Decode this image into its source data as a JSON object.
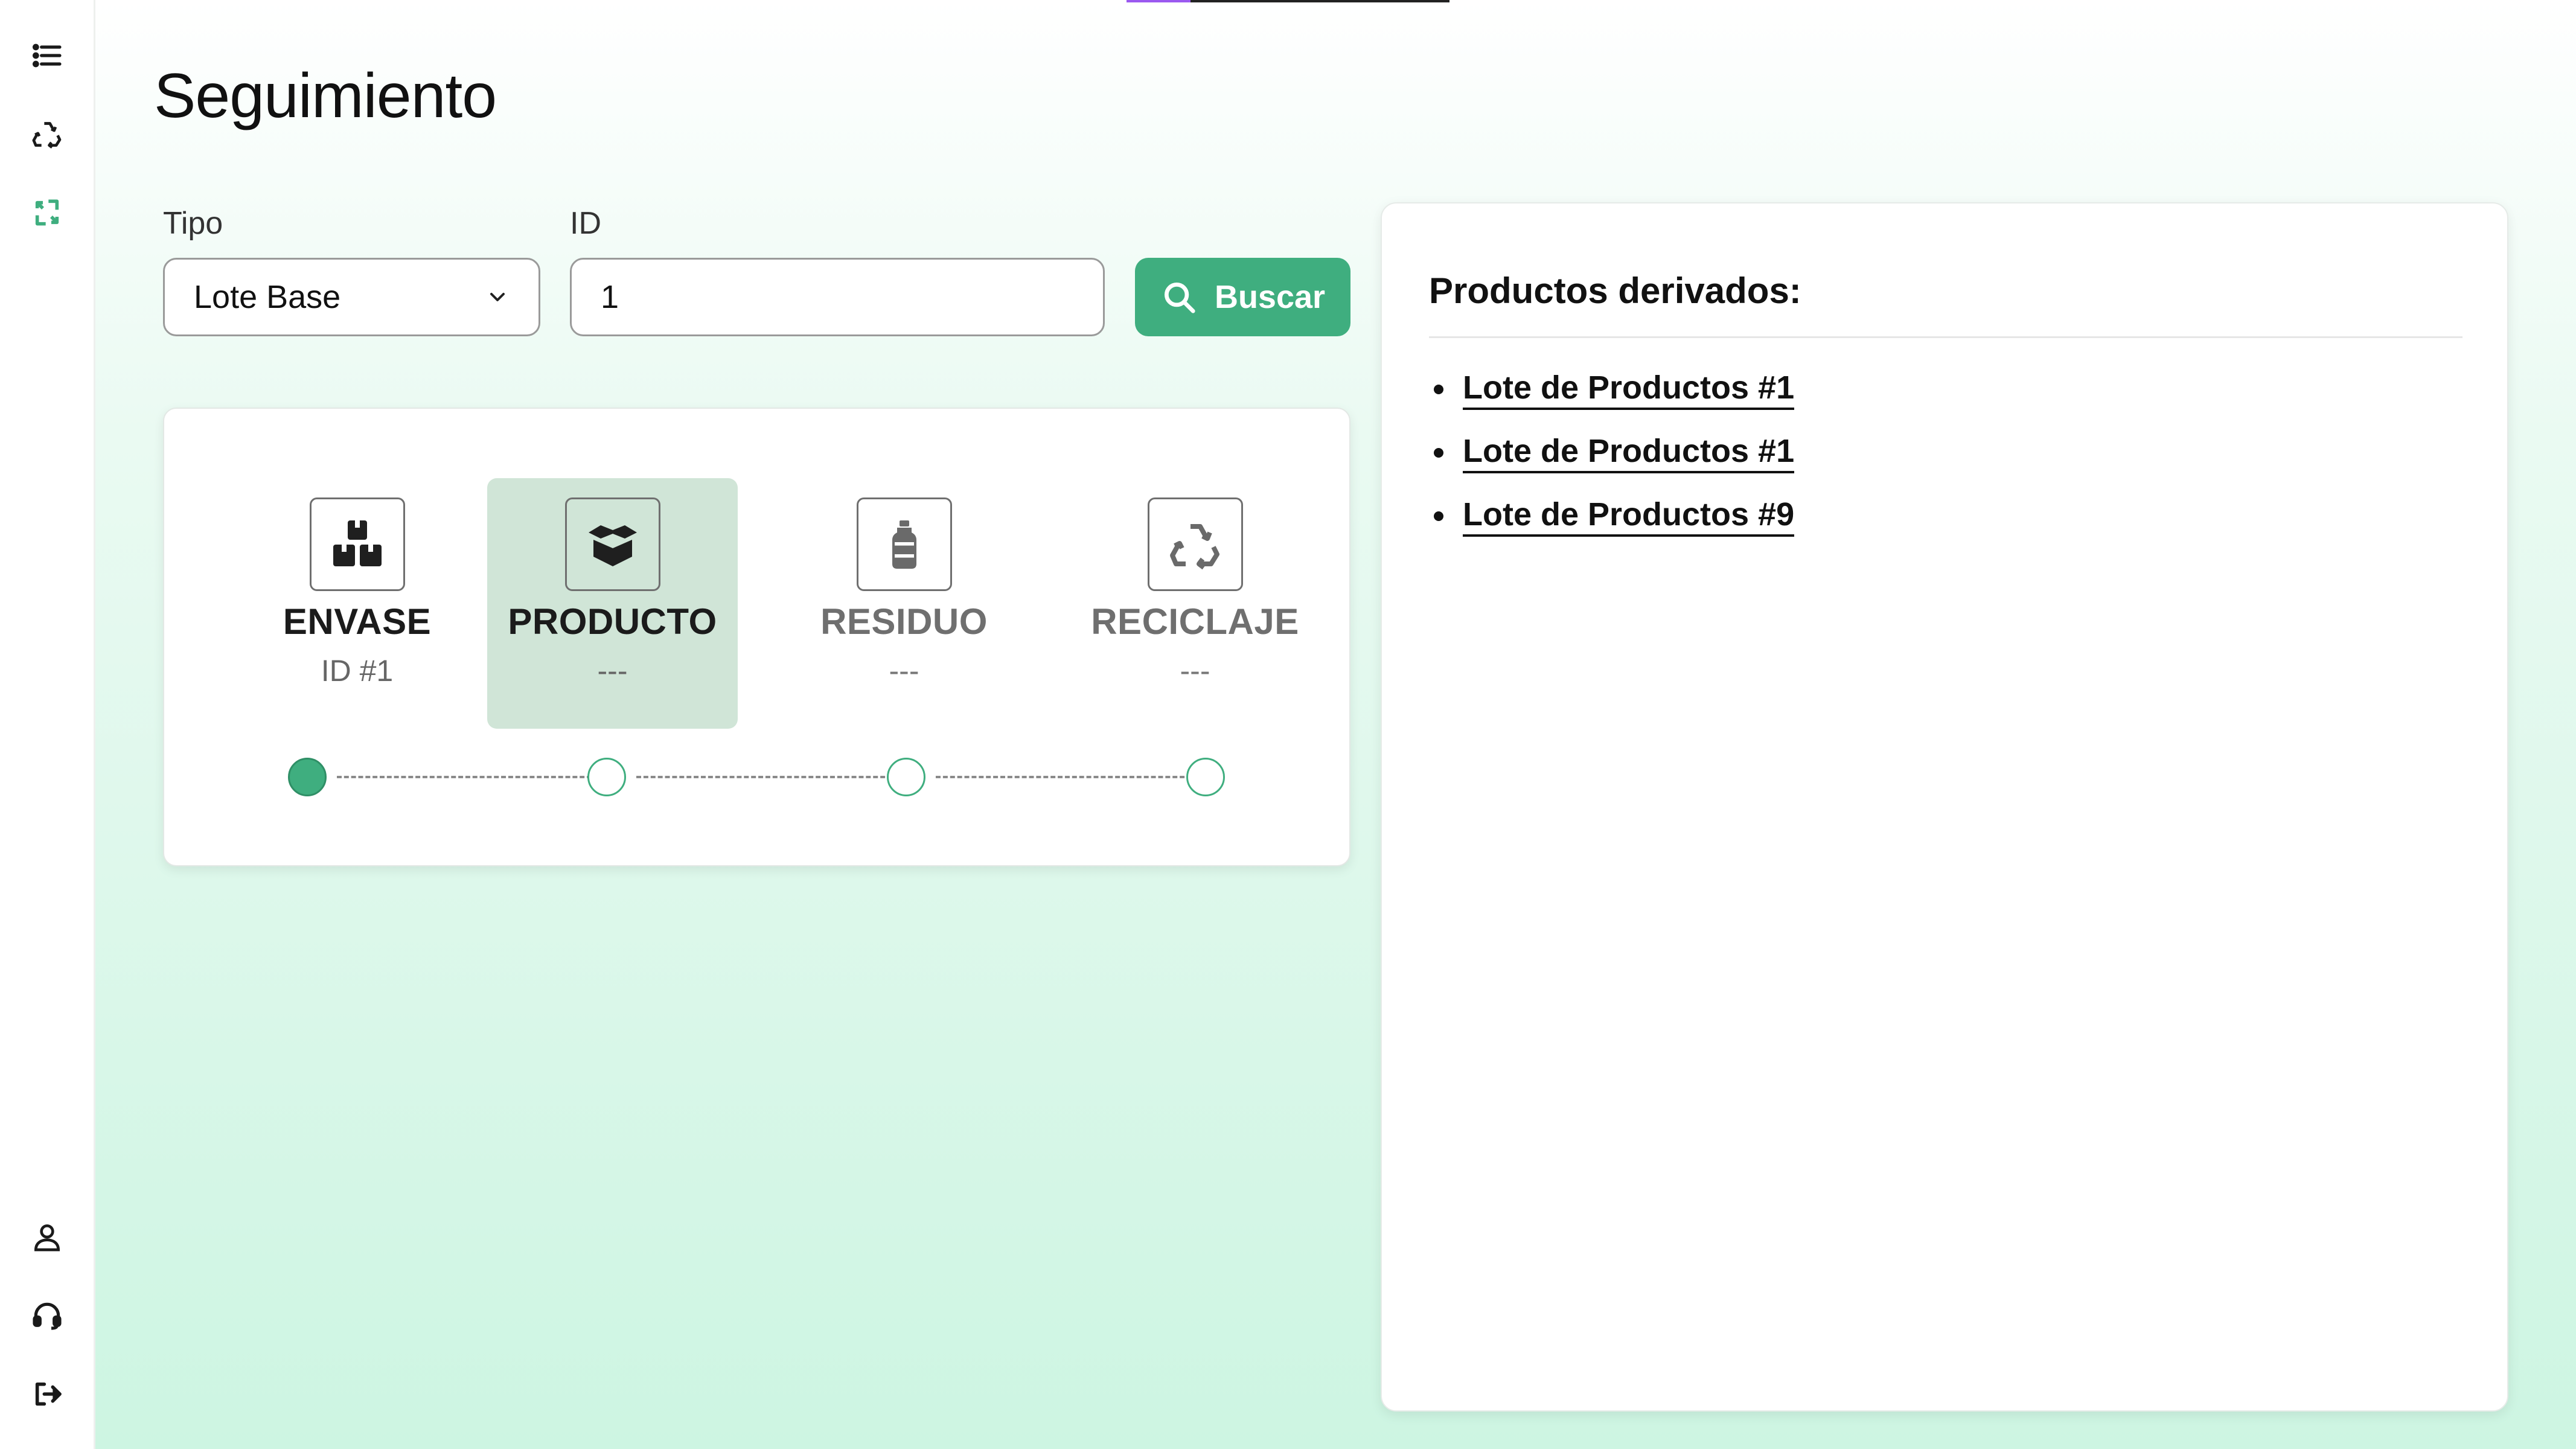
{
  "page": {
    "title": "Seguimiento"
  },
  "sidebar": {
    "top_items": [
      {
        "icon": "list-icon"
      },
      {
        "icon": "recycle-icon"
      },
      {
        "icon": "refresh-icon",
        "active": true
      }
    ],
    "bottom_items": [
      {
        "icon": "user-icon"
      },
      {
        "icon": "headset-icon"
      },
      {
        "icon": "logout-icon"
      }
    ]
  },
  "form": {
    "type_label": "Tipo",
    "type_value": "Lote Base",
    "id_label": "ID",
    "id_value": "1",
    "search_label": "Buscar"
  },
  "stepper": {
    "steps": [
      {
        "name": "ENVASE",
        "sub": "ID #1",
        "icon": "boxes-icon"
      },
      {
        "name": "PRODUCTO",
        "sub": "---",
        "icon": "open-box-icon",
        "highlighted": true
      },
      {
        "name": "RESIDUO",
        "sub": "---",
        "icon": "bottle-icon"
      },
      {
        "name": "RECICLAJE",
        "sub": "---",
        "icon": "recycle-icon"
      }
    ],
    "completed_steps": 1
  },
  "derived": {
    "title": "Productos derivados:",
    "items": [
      "Lote de Productos #1",
      "Lote de Productos #1",
      "Lote de Productos #9"
    ]
  },
  "colors": {
    "accent": "#3fae7f",
    "highlight": "#d0e5d7",
    "progress_accent": "#9b59f0"
  }
}
